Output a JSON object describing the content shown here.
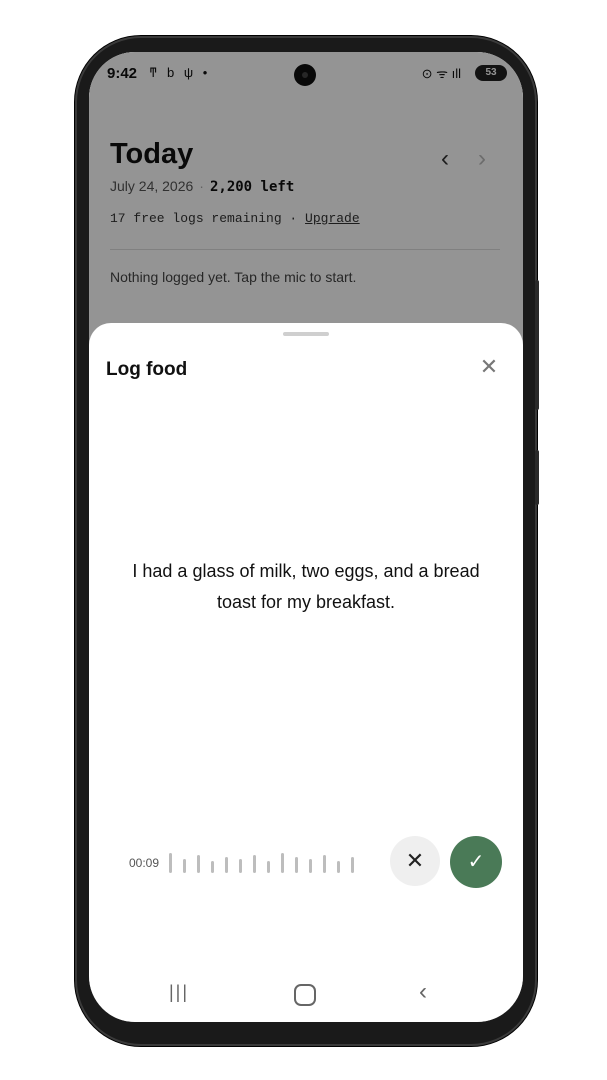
{
  "status_bar": {
    "time": "9:42",
    "left_icons": "ͳ b ψ •",
    "right_icons": "⊙ ᯤ ıll",
    "battery": "53"
  },
  "header": {
    "title": "Today",
    "date": "July 24, 2026",
    "separator": "·",
    "remaining": "2,200 left",
    "free_logs_text": "17 free logs remaining · ",
    "upgrade_link": "Upgrade"
  },
  "empty_state": "Nothing logged yet. Tap the mic to start.",
  "sheet": {
    "title": "Log food",
    "transcript": "I had a glass of milk, two eggs, and a bread toast for my breakfast.",
    "timer": "00:09"
  },
  "icons": {
    "prev": "‹",
    "next": "›",
    "close": "✕",
    "cancel": "✕",
    "confirm": "✓",
    "recents": "|||",
    "back": "‹"
  }
}
